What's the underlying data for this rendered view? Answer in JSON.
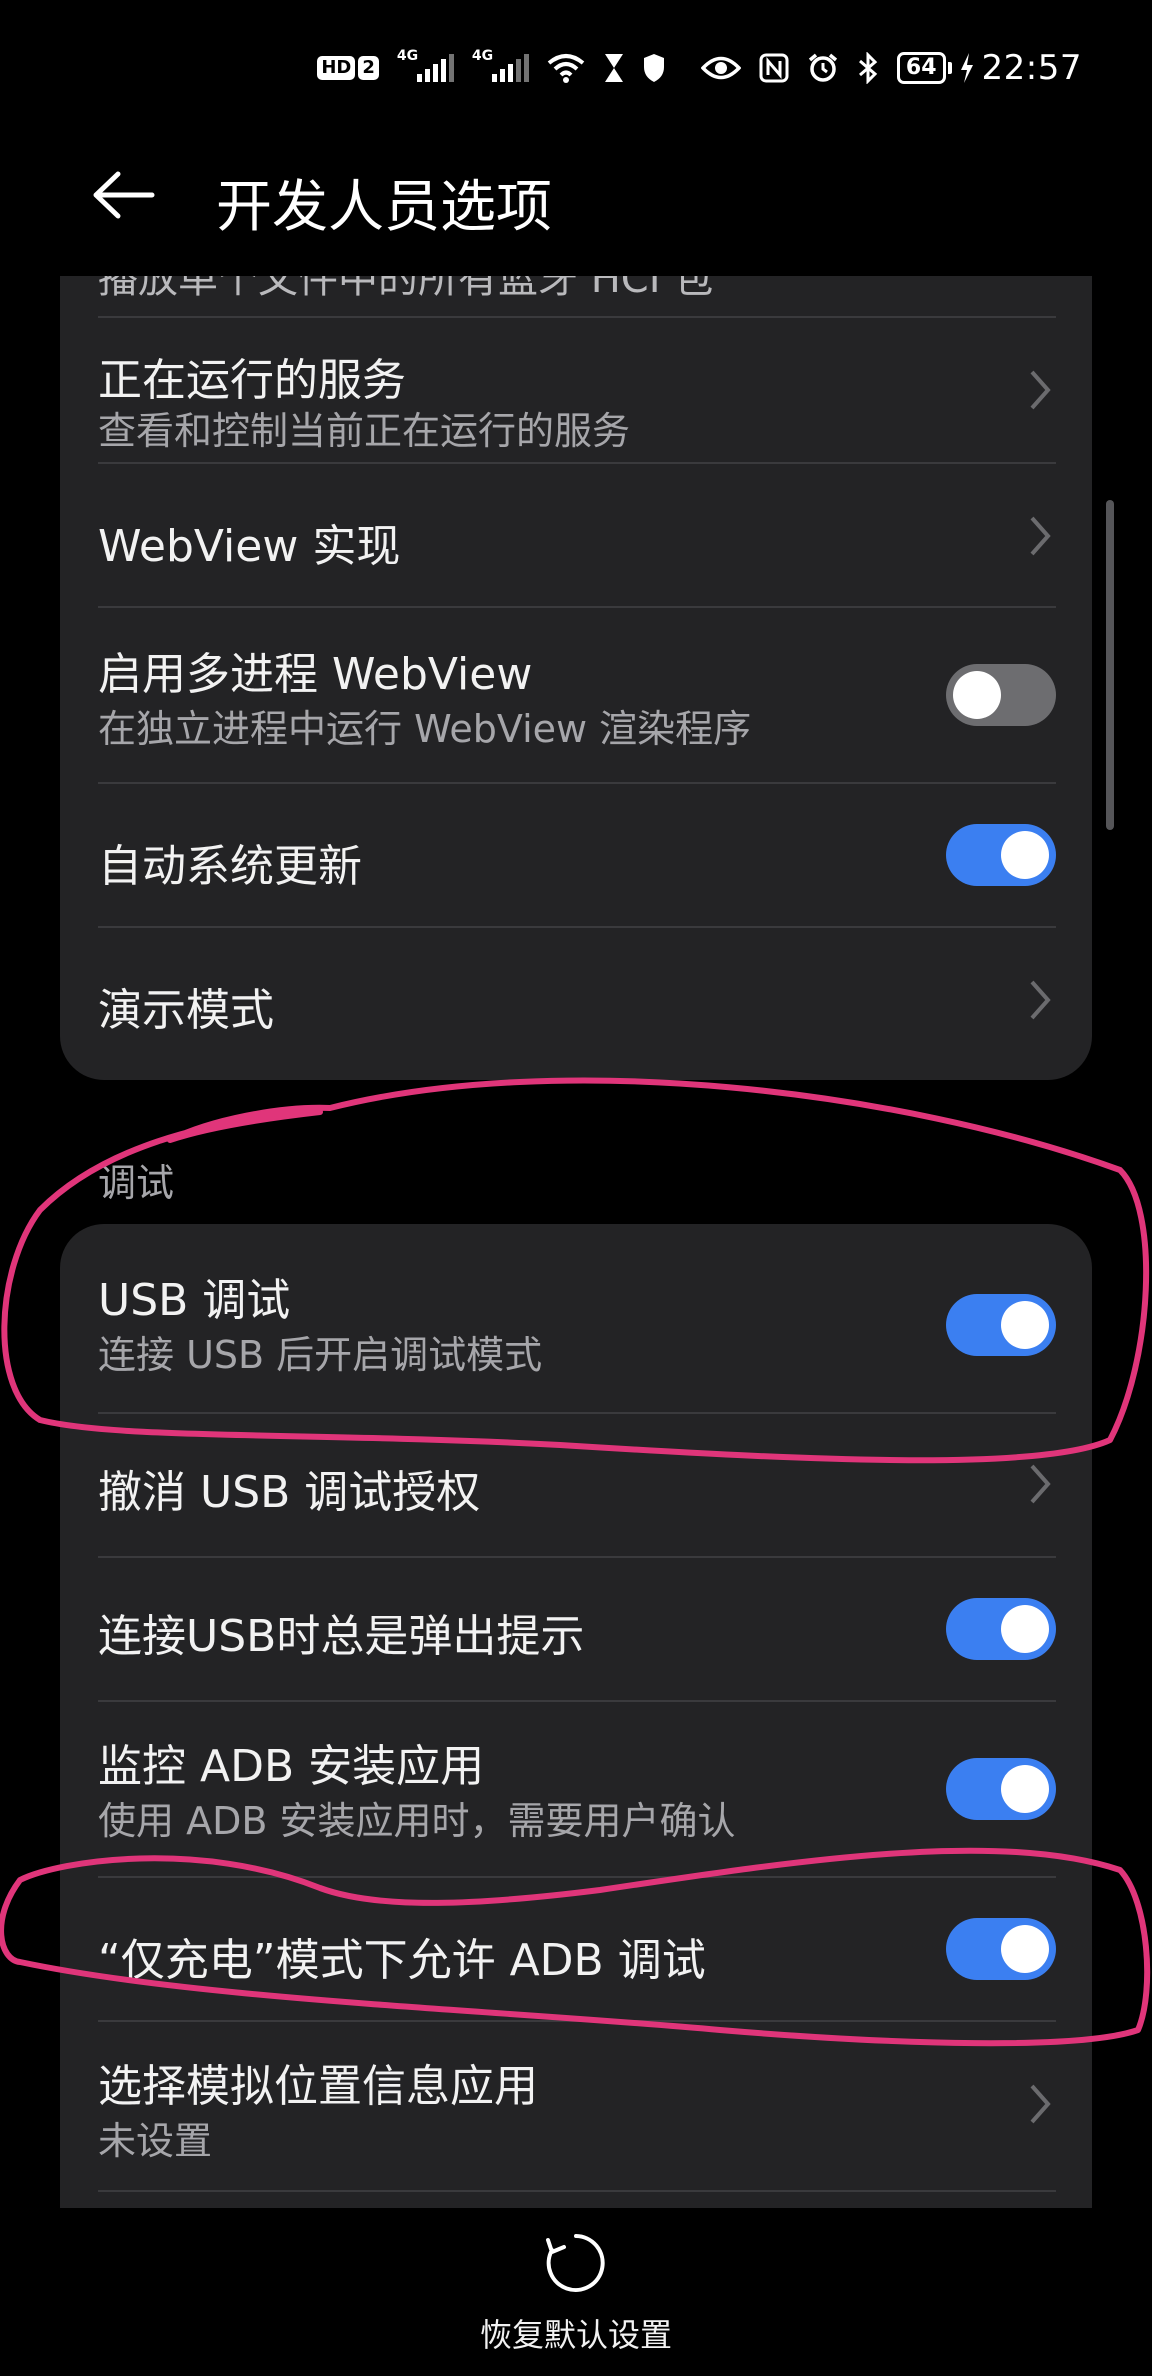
{
  "status_bar": {
    "hd_label": "HD",
    "sim_slot": "2",
    "sig1_label": "4G",
    "sig2_label": "4G",
    "battery": "64",
    "time": "22:57"
  },
  "header": {
    "title": "开发人员选项",
    "back_icon": "arrow-left-icon"
  },
  "settings_top": {
    "cut_text": "播放单个文件中的所有蓝牙 HCI 包",
    "items": [
      {
        "title": "正在运行的服务",
        "subtitle": "查看和控制当前正在运行的服务",
        "control": "chevron"
      },
      {
        "title": "WebView 实现",
        "control": "chevron"
      },
      {
        "title": "启用多进程 WebView",
        "subtitle": "在独立进程中运行 WebView 渲染程序",
        "control": "toggle",
        "on": false
      },
      {
        "title": "自动系统更新",
        "control": "toggle",
        "on": true
      },
      {
        "title": "演示模式",
        "control": "chevron"
      }
    ]
  },
  "section_debug": {
    "label": "调试",
    "items": [
      {
        "title": "USB 调试",
        "subtitle": "连接 USB 后开启调试模式",
        "control": "toggle",
        "on": true
      },
      {
        "title": "撤消 USB 调试授权",
        "control": "chevron"
      },
      {
        "title": "连接USB时总是弹出提示",
        "control": "toggle",
        "on": true
      },
      {
        "title": "监控 ADB 安装应用",
        "subtitle": "使用 ADB 安装应用时，需要用户确认",
        "control": "toggle",
        "on": true
      },
      {
        "title": "“仅充电”模式下允许 ADB 调试",
        "control": "toggle",
        "on": true
      },
      {
        "title": "选择模拟位置信息应用",
        "subtitle": "未设置",
        "control": "chevron"
      }
    ]
  },
  "footer": {
    "reset_label": "恢复默认设置",
    "reset_icon": "refresh-icon"
  },
  "colors": {
    "background": "#000000",
    "card": "#232325",
    "toggle_on": "#3b7ff1",
    "toggle_off": "#6d6d70",
    "annotation": "#e0357a"
  }
}
